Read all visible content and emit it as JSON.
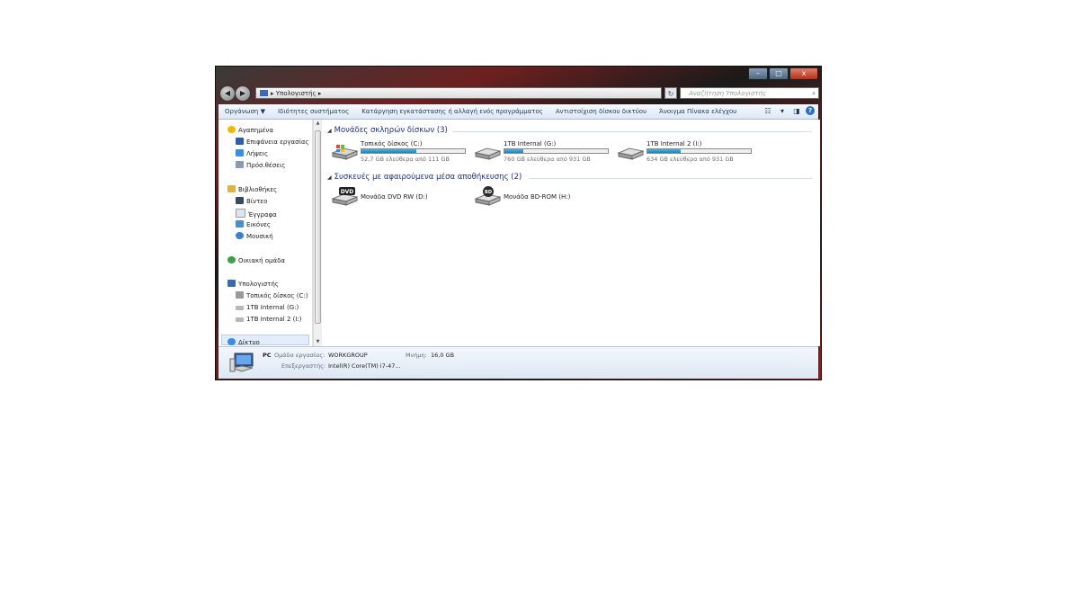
{
  "window": {
    "caption_buttons": {
      "minimize": "–",
      "maximize": "□",
      "close": "x"
    }
  },
  "address": {
    "nav_back": "◀",
    "nav_forward": "▶",
    "path": "▸ Υπολογιστής ▸",
    "search_placeholder": "Αναζήτηση Υπολογιστής"
  },
  "toolbar": {
    "items": [
      "Οργάνωση ▼",
      "Ιδιότητες συστήματος",
      "Κατάργηση εγκατάστασης ή αλλαγή ενός προγράμματος",
      "Αντιστοίχιση δίσκου δικτύου",
      "Άνοιγμα Πίνακα ελέγχου"
    ]
  },
  "sidebar": {
    "favorites": {
      "label": "Αγαπημένα",
      "items": [
        "Επιφάνεια εργασίας",
        "Λήψεις",
        "Πρόσ.θέσεις"
      ]
    },
    "libraries": {
      "label": "Βιβλιοθήκες",
      "items": [
        "Βίντεο",
        "Έγγραφα",
        "Εικόνες",
        "Μουσική"
      ]
    },
    "homegroup": "Οικιακή ομάδα",
    "computer": {
      "label": "Υπολογιστής",
      "items": [
        "Τοπικός δίσκος (C:)",
        "1TB Internal (G:)",
        "1TB Internal 2 (I:)"
      ]
    },
    "network": "Δίκτυο"
  },
  "content": {
    "hard_drives_header": "Μονάδες σκληρών δίσκων (3)",
    "drives": [
      {
        "name": "Τοπικός δίσκος (C:)",
        "free": "52,7 GB ελεύθερα από 111 GB",
        "used_fraction": 0.53
      },
      {
        "name": "1TB Internal (G:)",
        "free": "760 GB ελεύθερα από 931 GB",
        "used_fraction": 0.18
      },
      {
        "name": "1TB Internal 2 (I:)",
        "free": "634 GB ελεύθερα από 931 GB",
        "used_fraction": 0.32
      }
    ],
    "removable_header": "Συσκευές με αφαιρούμενα μέσα αποθήκευσης (2)",
    "removable": [
      {
        "name": "Μονάδα DVD RW (D:)",
        "badge": "DVD"
      },
      {
        "name": "Μονάδα BD-ROM (H:)",
        "badge": "BD"
      }
    ]
  },
  "details": {
    "name": "PC",
    "workgroup_label": "Ομάδα εργασίας:",
    "workgroup": "WORKGROUP",
    "memory_label": "Μνήμη:",
    "memory": "16,0 GB",
    "processor_label": "Επεξεργαστής:",
    "processor": "Intel(R) Core(TM) i7-47..."
  },
  "colors": {
    "group_header": "#1e3287",
    "bar_fill": "#2a9ad4",
    "toolbar_bg": "#e8eff8"
  }
}
